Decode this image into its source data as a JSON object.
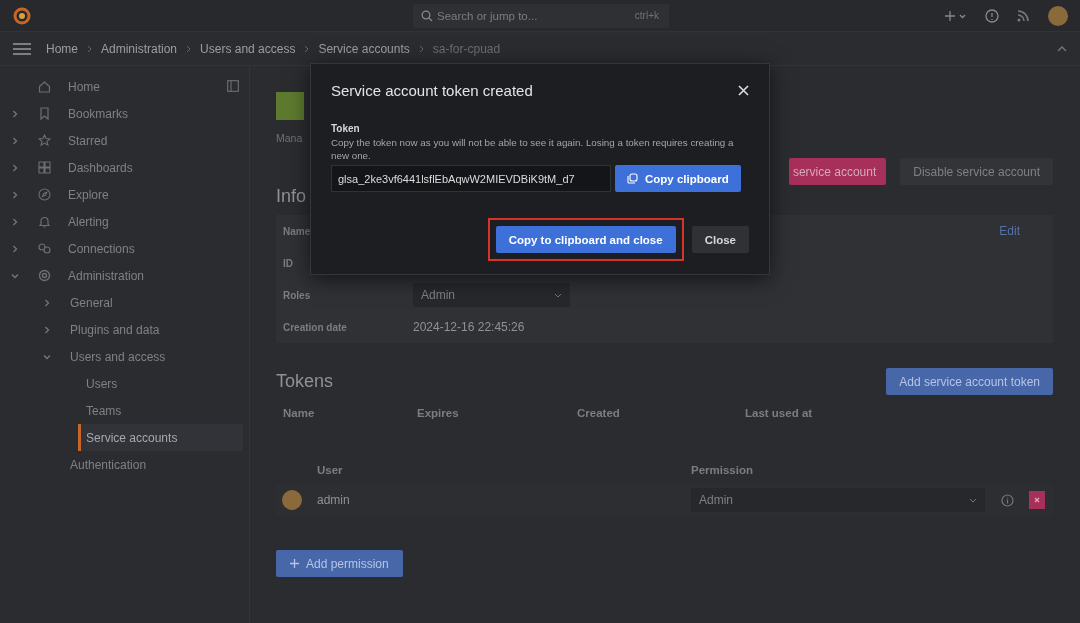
{
  "top_bar": {
    "search": {
      "placeholder": "Search or jump to..."
    },
    "shortcut": "ctrl+k"
  },
  "breadcrumbs": [
    "Home",
    "Administration",
    "Users and access",
    "Service accounts",
    "sa-for-cpuad"
  ],
  "sidebar": {
    "items": [
      {
        "label": "Home",
        "kind": "link",
        "selected": false
      },
      {
        "label": "Bookmarks",
        "kind": "group",
        "expanded": false,
        "selected": false
      },
      {
        "label": "Starred",
        "kind": "group",
        "expanded": false,
        "selected": false
      },
      {
        "label": "Dashboards",
        "kind": "group",
        "expanded": false,
        "selected": false
      },
      {
        "label": "Explore",
        "kind": "group",
        "expanded": false,
        "selected": false
      },
      {
        "label": "Alerting",
        "kind": "group",
        "expanded": false,
        "selected": false
      },
      {
        "label": "Connections",
        "kind": "group",
        "expanded": false,
        "selected": false
      },
      {
        "label": "Administration",
        "kind": "group",
        "expanded": true,
        "selected": false,
        "children": [
          {
            "label": "General",
            "kind": "group",
            "expanded": false,
            "selected": false
          },
          {
            "label": "Plugins and data",
            "kind": "group",
            "expanded": false,
            "selected": false
          },
          {
            "label": "Users and access",
            "kind": "group",
            "expanded": true,
            "selected": false,
            "children": [
              {
                "label": "Users",
                "selected": false
              },
              {
                "label": "Teams",
                "selected": false
              },
              {
                "label": "Service accounts",
                "selected": true
              }
            ]
          },
          {
            "label": "Authentication",
            "kind": "link",
            "selected": false
          }
        ]
      }
    ]
  },
  "account": {
    "description": "Mana",
    "buttons": [
      {
        "label": "service account",
        "kind": "danger"
      },
      {
        "label": "Disable service account",
        "kind": "secondary"
      }
    ]
  },
  "info": {
    "title": "Info",
    "edit": "Edit",
    "rows": [
      {
        "label": "Name",
        "kind": "text"
      },
      {
        "label": "ID",
        "kind": "text"
      },
      {
        "label": "Roles",
        "kind": "select",
        "value": "Admin"
      },
      {
        "label": "Creation date",
        "kind": "text",
        "value": "2024-12-16 22:45:26"
      }
    ]
  },
  "tokens": {
    "title": "Tokens",
    "add_button": "Add service account token",
    "columns": [
      "Name",
      "Expires",
      "Created",
      "Last used at"
    ]
  },
  "permissions": {
    "columns": [
      "User",
      "Permission"
    ],
    "rows": [
      {
        "user": "admin",
        "permission": "Admin"
      }
    ],
    "add_button": "Add permission"
  },
  "modal": {
    "title": "Service account token created",
    "token_label": "Token",
    "description": "Copy the token now as you will not be able to see it again. Losing a token requires creating a new one.",
    "token_value": "glsa_2ke3vf6441lsflEbAqwW2MIEVDBiK9tM_d7",
    "copy_button": "Copy clipboard",
    "primary_button": "Copy to clipboard and close",
    "close_button": "Close",
    "highlighted": true
  }
}
